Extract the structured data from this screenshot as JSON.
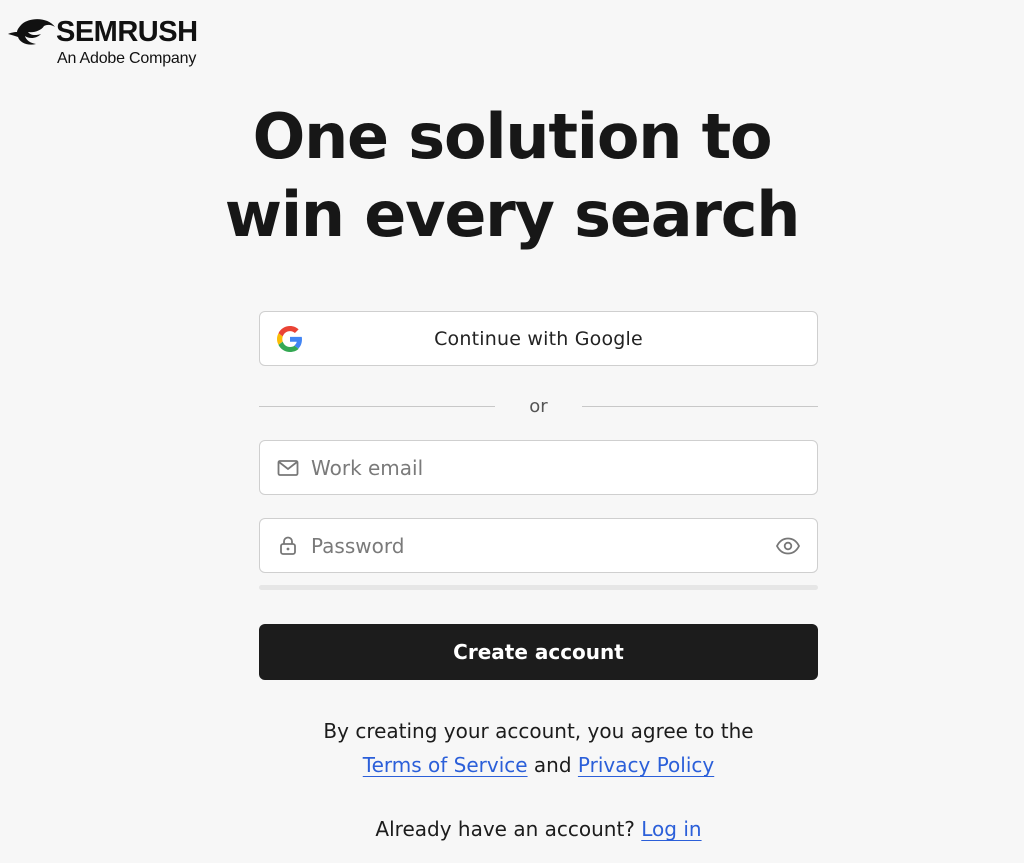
{
  "brand": {
    "name": "SEMRUSH",
    "tagline": "An Adobe Company",
    "logo_icon": "semrush-fireball-icon"
  },
  "headline": {
    "line1": "One solution to",
    "line2": "win every search"
  },
  "google_button": {
    "label": "Continue with Google",
    "icon": "google-g-icon"
  },
  "divider": {
    "text": "or"
  },
  "email_field": {
    "placeholder": "Work email",
    "value": "",
    "icon": "mail-icon"
  },
  "password_field": {
    "placeholder": "Password",
    "value": "",
    "icon": "lock-icon",
    "toggle_icon": "eye-icon"
  },
  "create_button": {
    "label": "Create account"
  },
  "legal": {
    "prefix": "By creating your account, you agree to the",
    "terms_link": "Terms of Service",
    "conjunction": "and",
    "privacy_link": "Privacy Policy"
  },
  "login": {
    "prompt": "Already have an account?",
    "link": "Log in"
  },
  "colors": {
    "background": "#f7f7f7",
    "button_dark": "#1c1c1c",
    "link": "#2b5fd9",
    "border": "#cfcfcf"
  }
}
